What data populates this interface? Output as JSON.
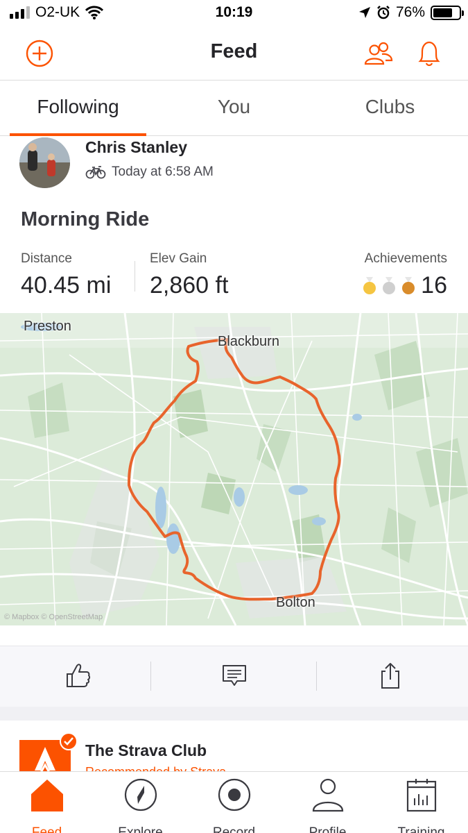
{
  "status_bar": {
    "carrier": "O2-UK",
    "time": "10:19",
    "battery": "76%",
    "battery_level": 0.76
  },
  "header": {
    "title": "Feed"
  },
  "tabs": [
    {
      "label": "Following",
      "active": true
    },
    {
      "label": "You",
      "active": false
    },
    {
      "label": "Clubs",
      "active": false
    }
  ],
  "activity": {
    "athlete": "Chris Stanley",
    "time": "Today at 6:58 AM",
    "title": "Morning Ride",
    "stats": {
      "distance_label": "Distance",
      "distance_value": "40.45 mi",
      "elev_label": "Elev Gain",
      "elev_value": "2,860 ft",
      "achievements_label": "Achievements",
      "achievements_value": "16"
    },
    "map": {
      "labels": [
        "Preston",
        "Blackburn",
        "Bolton"
      ],
      "attribution": "© Mapbox © OpenStreetMap"
    }
  },
  "club": {
    "name": "The Strava Club",
    "subtitle": "Recommended by Strava"
  },
  "bottom_nav": [
    {
      "label": "Feed",
      "icon": "home-icon",
      "active": true
    },
    {
      "label": "Explore",
      "icon": "compass-icon",
      "active": false
    },
    {
      "label": "Record",
      "icon": "record-icon",
      "active": false
    },
    {
      "label": "Profile",
      "icon": "profile-icon",
      "active": false
    },
    {
      "label": "Training",
      "icon": "training-icon",
      "active": false
    }
  ],
  "colors": {
    "accent": "#fc5200",
    "text": "#242428",
    "route": "#e8642c"
  }
}
